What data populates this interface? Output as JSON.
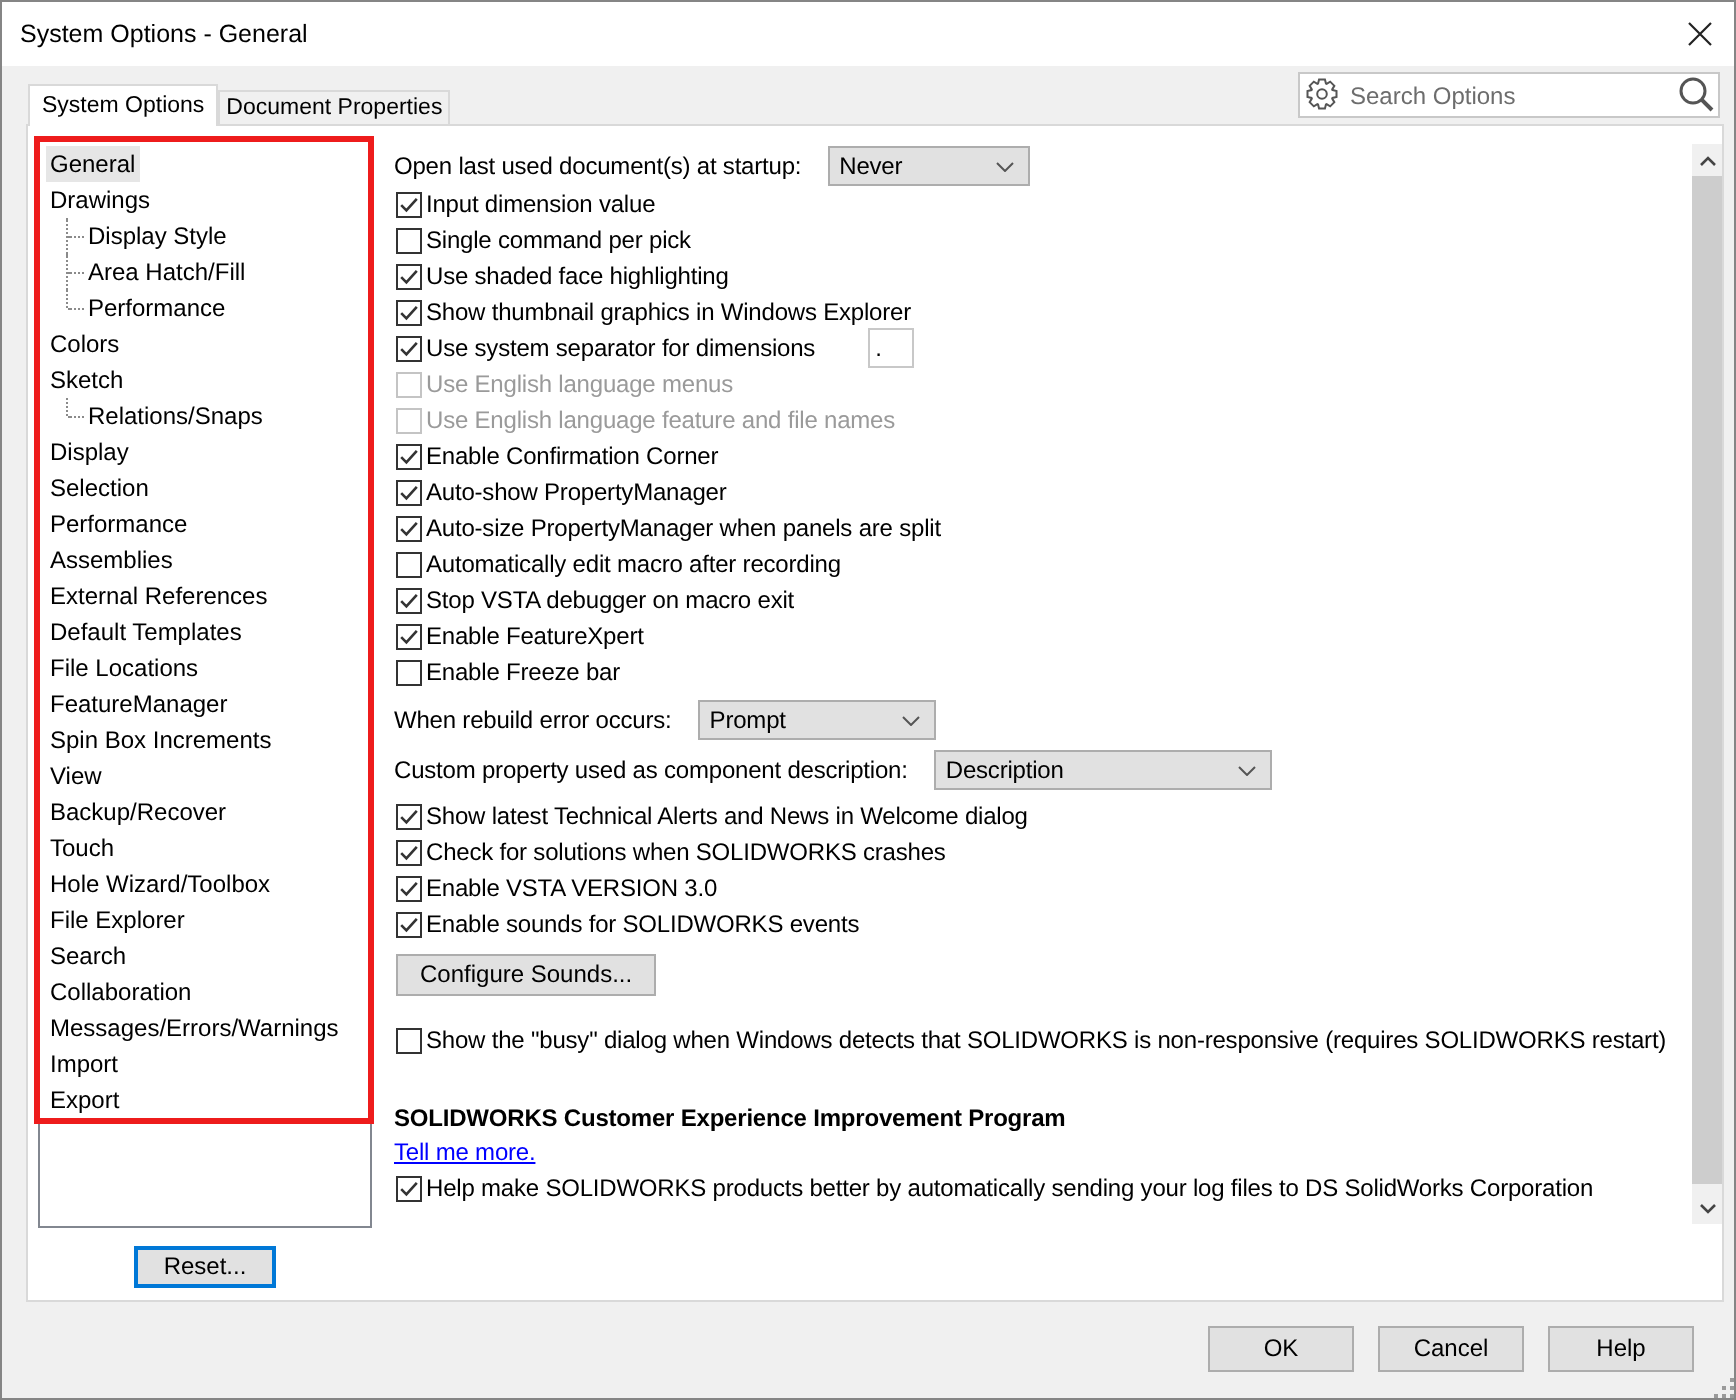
{
  "window": {
    "title": "System Options - General"
  },
  "tabs": [
    {
      "label": "System Options",
      "selected": true
    },
    {
      "label": "Document Properties",
      "selected": false
    }
  ],
  "search": {
    "placeholder": "Search Options"
  },
  "tree": {
    "highlighted": true,
    "items": [
      {
        "label": "General",
        "selected": true
      },
      {
        "label": "Drawings",
        "selected": false,
        "children": [
          {
            "label": "Display Style",
            "selected": false
          },
          {
            "label": "Area Hatch/Fill",
            "selected": false
          },
          {
            "label": "Performance",
            "selected": false
          }
        ]
      },
      {
        "label": "Colors",
        "selected": false
      },
      {
        "label": "Sketch",
        "selected": false,
        "children": [
          {
            "label": "Relations/Snaps",
            "selected": false
          }
        ]
      },
      {
        "label": "Display",
        "selected": false
      },
      {
        "label": "Selection",
        "selected": false
      },
      {
        "label": "Performance",
        "selected": false
      },
      {
        "label": "Assemblies",
        "selected": false
      },
      {
        "label": "External References",
        "selected": false
      },
      {
        "label": "Default Templates",
        "selected": false
      },
      {
        "label": "File Locations",
        "selected": false
      },
      {
        "label": "FeatureManager",
        "selected": false
      },
      {
        "label": "Spin Box Increments",
        "selected": false
      },
      {
        "label": "View",
        "selected": false
      },
      {
        "label": "Backup/Recover",
        "selected": false
      },
      {
        "label": "Touch",
        "selected": false
      },
      {
        "label": "Hole Wizard/Toolbox",
        "selected": false
      },
      {
        "label": "File Explorer",
        "selected": false
      },
      {
        "label": "Search",
        "selected": false
      },
      {
        "label": "Collaboration",
        "selected": false
      },
      {
        "label": "Messages/Errors/Warnings",
        "selected": false
      },
      {
        "label": "Import",
        "selected": false
      },
      {
        "label": "Export",
        "selected": false
      }
    ]
  },
  "reset_button": {
    "label": "Reset...",
    "focused": true
  },
  "options": [
    {
      "kind": "select",
      "label": "Open last used document(s) at startup:",
      "value": "Never"
    },
    {
      "kind": "checkbox",
      "label": "Input dimension value",
      "checked": true,
      "disabled": false
    },
    {
      "kind": "checkbox",
      "label": "Single command per pick",
      "checked": false,
      "disabled": false
    },
    {
      "kind": "checkbox",
      "label": "Use shaded face highlighting",
      "checked": true,
      "disabled": false
    },
    {
      "kind": "checkbox",
      "label": "Show thumbnail graphics in Windows Explorer",
      "checked": true,
      "disabled": false
    },
    {
      "kind": "checkbox",
      "label": "Use system separator for dimensions",
      "checked": true,
      "disabled": false,
      "input_value": "."
    },
    {
      "kind": "checkbox",
      "label": "Use English language menus",
      "checked": false,
      "disabled": true
    },
    {
      "kind": "checkbox",
      "label": "Use English language feature and file names",
      "checked": false,
      "disabled": true
    },
    {
      "kind": "checkbox",
      "label": "Enable Confirmation Corner",
      "checked": true,
      "disabled": false
    },
    {
      "kind": "checkbox",
      "label": "Auto-show PropertyManager",
      "checked": true,
      "disabled": false
    },
    {
      "kind": "checkbox",
      "label": "Auto-size PropertyManager when panels are split",
      "checked": true,
      "disabled": false
    },
    {
      "kind": "checkbox",
      "label": "Automatically edit macro after recording",
      "checked": false,
      "disabled": false
    },
    {
      "kind": "checkbox",
      "label": "Stop VSTA debugger on macro exit",
      "checked": true,
      "disabled": false
    },
    {
      "kind": "checkbox",
      "label": "Enable FeatureXpert",
      "checked": true,
      "disabled": false
    },
    {
      "kind": "checkbox",
      "label": "Enable Freeze bar",
      "checked": false,
      "disabled": false
    },
    {
      "kind": "select",
      "label": "When rebuild error occurs:",
      "value": "Prompt"
    },
    {
      "kind": "select",
      "label": "Custom property used as component description:",
      "value": "Description"
    },
    {
      "kind": "checkbox",
      "label": "Show latest Technical Alerts and News in Welcome dialog",
      "checked": true,
      "disabled": false
    },
    {
      "kind": "checkbox",
      "label": "Check for solutions when SOLIDWORKS crashes",
      "checked": true,
      "disabled": false
    },
    {
      "kind": "checkbox",
      "label": "Enable VSTA VERSION 3.0",
      "checked": true,
      "disabled": false
    },
    {
      "kind": "checkbox",
      "label": "Enable sounds for SOLIDWORKS events",
      "checked": true,
      "disabled": false
    },
    {
      "kind": "button",
      "label": "Configure Sounds..."
    }
  ],
  "busy_option": {
    "label": "Show the \"busy\" dialog when Windows detects that SOLIDWORKS is non-responsive (requires SOLIDWORKS restart)",
    "checked": false
  },
  "ceip": {
    "heading": "SOLIDWORKS Customer Experience Improvement Program",
    "link": "Tell me more.",
    "option": {
      "label": "Help make SOLIDWORKS products better by automatically sending your log files to DS SolidWorks Corporation",
      "checked": true
    }
  },
  "buttons": [
    "OK",
    "Cancel",
    "Help"
  ]
}
